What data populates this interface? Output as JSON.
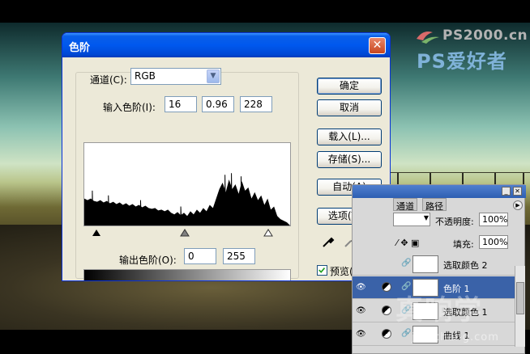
{
  "watermark": {
    "site": "PS2000.cn",
    "brand": "PS爱好者",
    "bottom_big": "真响学",
    "bottom_small": "jiaocheng.com"
  },
  "dialog": {
    "title": "色阶",
    "close_label": "✕",
    "channel_label": "通道(C):",
    "channel_value": "RGB",
    "input_levels_label": "输入色阶(I):",
    "input_black": "16",
    "input_gamma": "0.96",
    "input_white": "228",
    "output_levels_label": "输出色阶(O):",
    "output_black": "0",
    "output_white": "255",
    "buttons": {
      "ok": "确定",
      "cancel": "取消",
      "load": "载入(L)...",
      "save": "存储(S)...",
      "auto": "自动(A)",
      "options": "选项(T)..."
    },
    "preview_label": "预览(P)",
    "preview_checked": true,
    "accent": "#0058ee"
  },
  "layers_panel": {
    "tabs": [
      "通道",
      "路径"
    ],
    "opacity_label": "不透明度:",
    "opacity_value": "100%",
    "fill_label": "填充:",
    "fill_value": "100%",
    "layers": [
      {
        "name": "选取颜色 2",
        "selected": false
      },
      {
        "name": "色阶 1",
        "selected": true
      },
      {
        "name": "选取颜色 1",
        "selected": false
      },
      {
        "name": "曲线 1",
        "selected": false
      }
    ]
  }
}
